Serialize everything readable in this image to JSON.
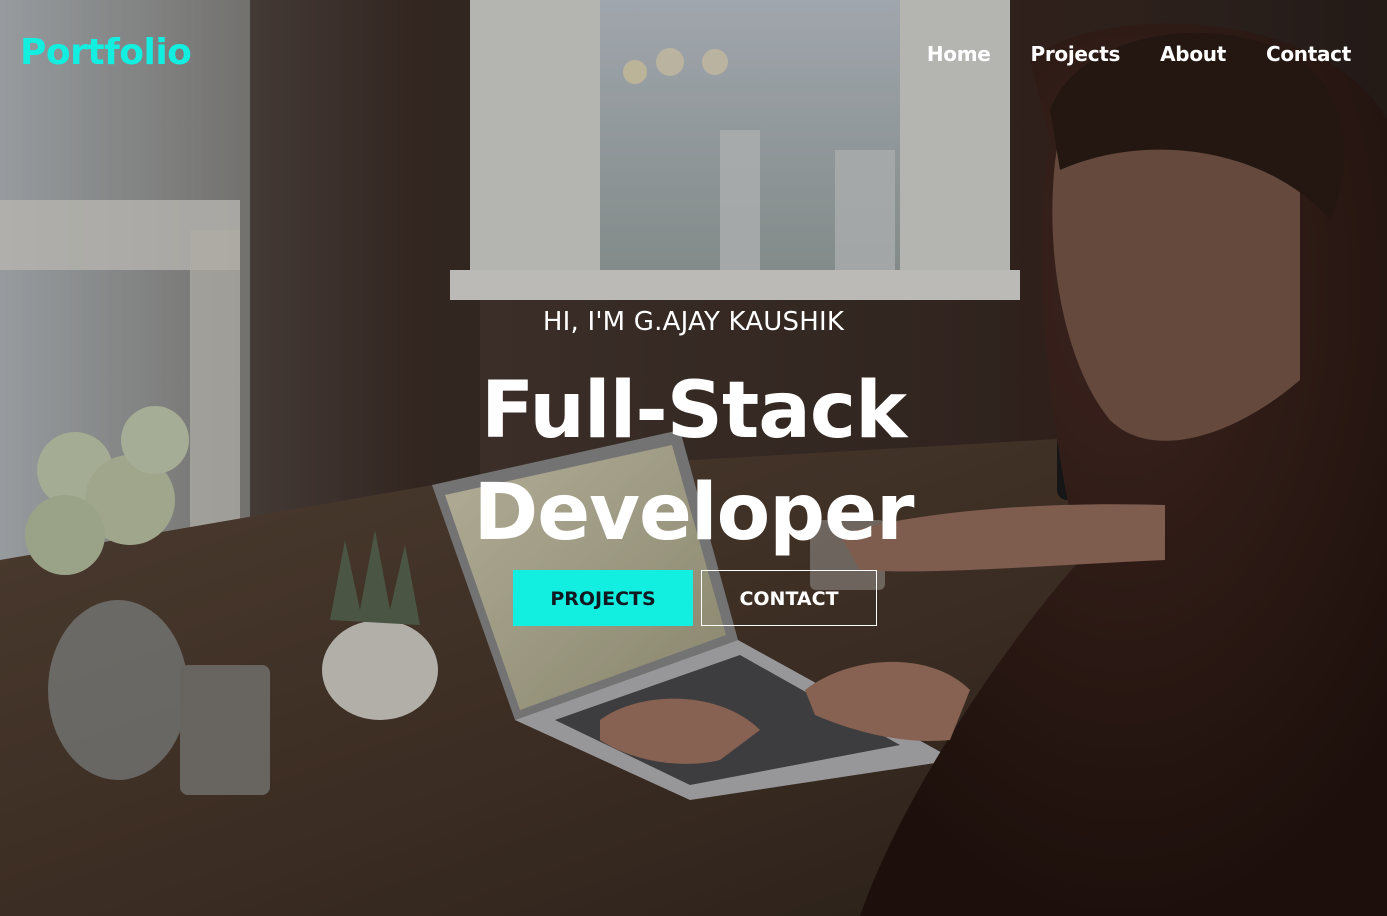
{
  "brand": {
    "logo_text": "Portfolio",
    "accent_color": "#12eee0"
  },
  "nav": {
    "items": [
      {
        "label": "Home"
      },
      {
        "label": "Projects"
      },
      {
        "label": "About"
      },
      {
        "label": "Contact"
      }
    ]
  },
  "hero": {
    "intro": "HI, I'M G.AJAY KAUSHIK",
    "title_line1": "Full-Stack",
    "title_line2": "Developer",
    "primary_button": "PROJECTS",
    "secondary_button": "CONTACT",
    "background_image": "developer-working-on-laptop-photo"
  }
}
